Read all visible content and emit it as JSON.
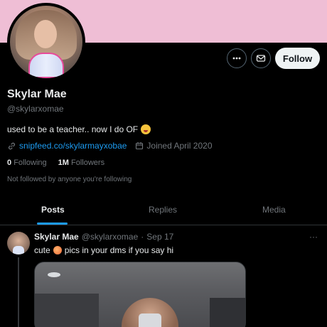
{
  "profile": {
    "name": "Skylar Mae",
    "handle": "@skylarxomae",
    "bio": "used to be a teacher.. now I do OF",
    "bio_emoji": "zany-face",
    "link": "snipfeed.co/skylarmayxobae",
    "joined": "Joined April 2020",
    "following_count": "0",
    "following_label": "Following",
    "followers_count": "1M",
    "followers_label": "Followers",
    "not_followed": "Not followed by anyone you're following",
    "banner_color": "#efbed5"
  },
  "actions": {
    "follow_label": "Follow",
    "more_icon": "more-icon",
    "message_icon": "envelope-icon"
  },
  "tabs": [
    {
      "label": "Posts",
      "active": true
    },
    {
      "label": "Replies",
      "active": false
    },
    {
      "label": "Media",
      "active": false
    }
  ],
  "post": {
    "author": "Skylar Mae",
    "handle": "@skylarxomae",
    "separator": "·",
    "date": "Sep 17",
    "text_before": "cute",
    "text_after": "pics in your dms if you say hi",
    "emoji": "peach",
    "more": "···"
  },
  "colors": {
    "accent": "#1d9bf0",
    "background": "#000000",
    "muted": "#71767b"
  }
}
